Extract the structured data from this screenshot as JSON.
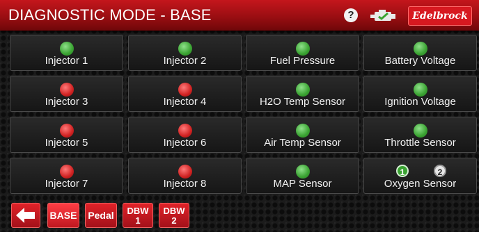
{
  "header": {
    "title": "DIAGNOSTIC MODE - BASE",
    "help_label": "?",
    "brand": "Edelbrock",
    "engine_icon": "engine-check-icon"
  },
  "tiles": [
    {
      "label": "Injector 1",
      "status": "green"
    },
    {
      "label": "Injector 2",
      "status": "green"
    },
    {
      "label": "Fuel Pressure",
      "status": "green"
    },
    {
      "label": "Battery Voltage",
      "status": "green"
    },
    {
      "label": "Injector 3",
      "status": "red"
    },
    {
      "label": "Injector 4",
      "status": "red"
    },
    {
      "label": "H2O Temp Sensor",
      "status": "green"
    },
    {
      "label": "Ignition Voltage",
      "status": "green"
    },
    {
      "label": "Injector 5",
      "status": "red"
    },
    {
      "label": "Injector 6",
      "status": "red"
    },
    {
      "label": "Air Temp Sensor",
      "status": "green"
    },
    {
      "label": "Throttle Sensor",
      "status": "green"
    },
    {
      "label": "Injector 7",
      "status": "red"
    },
    {
      "label": "Injector 8",
      "status": "red"
    },
    {
      "label": "MAP Sensor",
      "status": "green"
    },
    {
      "label": "Oxygen Sensor",
      "status": "o2",
      "o2": [
        "1",
        "2"
      ]
    }
  ],
  "nav": {
    "back_icon": "back-arrow-icon",
    "base": "BASE",
    "pedal": "Pedal",
    "dbw1_a": "DBW",
    "dbw1_b": "1",
    "dbw2_a": "DBW",
    "dbw2_b": "2"
  },
  "colors": {
    "accent_red": "#c4161c",
    "status_green": "#3aa332",
    "status_red": "#d02222"
  }
}
